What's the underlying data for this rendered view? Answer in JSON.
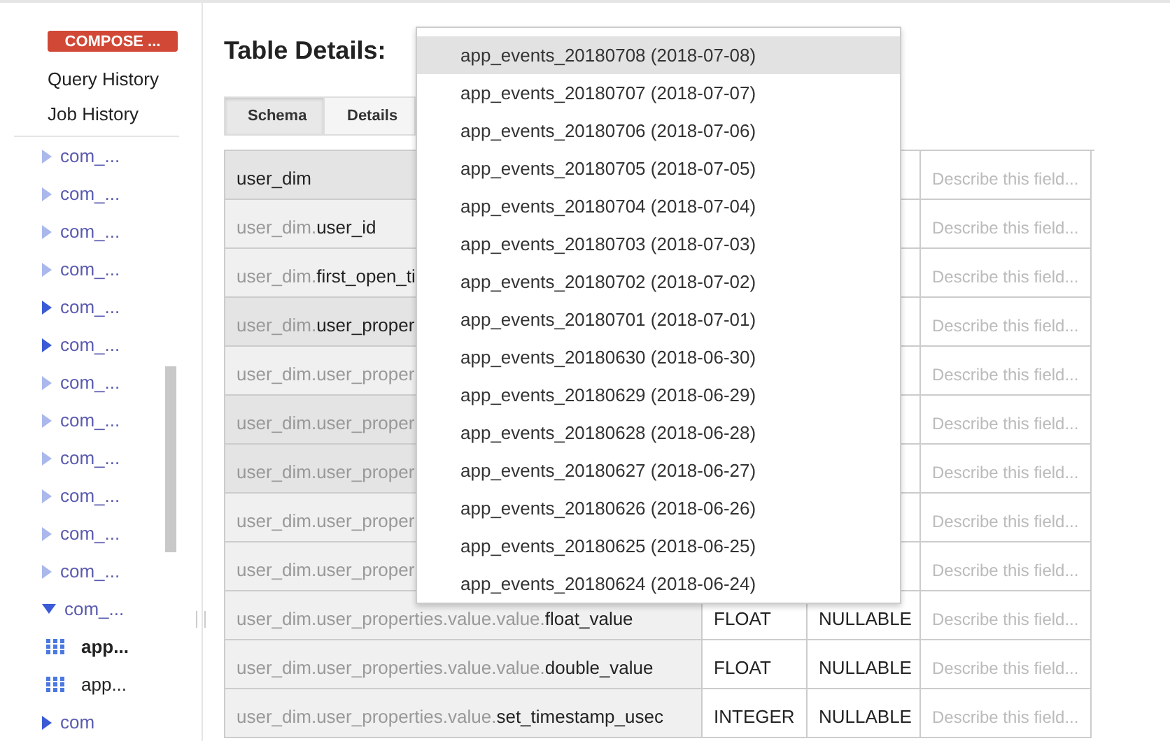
{
  "sidebar": {
    "compose_button": "COMPOSE ...",
    "links": [
      "Query History",
      "Job History"
    ],
    "tree": [
      {
        "label": "com_...",
        "expanded": false,
        "highlighted": false
      },
      {
        "label": "com_...",
        "expanded": false,
        "highlighted": false
      },
      {
        "label": "com_...",
        "expanded": false,
        "highlighted": false
      },
      {
        "label": "com_...",
        "expanded": false,
        "highlighted": false
      },
      {
        "label": "com_...",
        "expanded": false,
        "highlighted": true
      },
      {
        "label": "com_...",
        "expanded": false,
        "highlighted": true
      },
      {
        "label": "com_...",
        "expanded": false,
        "highlighted": false
      },
      {
        "label": "com_...",
        "expanded": false,
        "highlighted": false
      },
      {
        "label": "com_...",
        "expanded": false,
        "highlighted": false
      },
      {
        "label": "com_...",
        "expanded": false,
        "highlighted": false
      },
      {
        "label": "com_...",
        "expanded": false,
        "highlighted": false
      },
      {
        "label": "com_...",
        "expanded": false,
        "highlighted": false
      },
      {
        "label": "com_...",
        "expanded": true,
        "highlighted": true,
        "children": [
          {
            "label": "app...",
            "selected": true
          },
          {
            "label": "app...",
            "selected": false
          }
        ]
      },
      {
        "label": "com",
        "expanded": false,
        "highlighted": true
      }
    ]
  },
  "main": {
    "title": "Table Details:",
    "tabs": [
      {
        "label": "Schema",
        "selected": true
      },
      {
        "label": "Details",
        "selected": false
      }
    ],
    "table": {
      "rows": [
        {
          "kind": "record",
          "parent": "",
          "field": "user_dim",
          "description": "Describe this field..."
        },
        {
          "kind": "field",
          "parent": "user_dim.",
          "field": "user_id",
          "description": "Describe this field..."
        },
        {
          "kind": "field",
          "parent": "user_dim.",
          "field": "first_open_ti",
          "description": "Describe this field..."
        },
        {
          "kind": "record",
          "parent": "user_dim.",
          "field": "user_proper",
          "description": "Describe this field..."
        },
        {
          "kind": "field",
          "parent": "user_dim.user_proper",
          "field": "",
          "description": "Describe this field..."
        },
        {
          "kind": "record",
          "parent": "user_dim.user_proper",
          "field": "",
          "description": "Describe this field..."
        },
        {
          "kind": "record",
          "parent": "user_dim.user_proper",
          "field": "",
          "description": "Describe this field..."
        },
        {
          "kind": "field",
          "parent": "user_dim.user_proper",
          "field": "",
          "description": "Describe this field..."
        },
        {
          "kind": "field",
          "parent": "user_dim.user_proper",
          "field": "",
          "description": "Describe this field..."
        },
        {
          "kind": "field",
          "parent": "user_dim.user_properties.value.value.",
          "field": "float_value",
          "type": "FLOAT",
          "mode": "NULLABLE",
          "description": "Describe this field..."
        },
        {
          "kind": "field",
          "parent": "user_dim.user_properties.value.value.",
          "field": "double_value",
          "type": "FLOAT",
          "mode": "NULLABLE",
          "description": "Describe this field..."
        },
        {
          "kind": "field",
          "parent": "user_dim.user_properties.value.",
          "field": "set_timestamp_usec",
          "type": "INTEGER",
          "mode": "NULLABLE",
          "description": "Describe this field..."
        }
      ]
    }
  },
  "dropdown": {
    "items": [
      {
        "label": "app_events_20180708 (2018-07-08)",
        "selected": true
      },
      {
        "label": "app_events_20180707 (2018-07-07)",
        "selected": false
      },
      {
        "label": "app_events_20180706 (2018-07-06)",
        "selected": false
      },
      {
        "label": "app_events_20180705 (2018-07-05)",
        "selected": false
      },
      {
        "label": "app_events_20180704 (2018-07-04)",
        "selected": false
      },
      {
        "label": "app_events_20180703 (2018-07-03)",
        "selected": false
      },
      {
        "label": "app_events_20180702 (2018-07-02)",
        "selected": false
      },
      {
        "label": "app_events_20180701 (2018-07-01)",
        "selected": false
      },
      {
        "label": "app_events_20180630 (2018-06-30)",
        "selected": false
      },
      {
        "label": "app_events_20180629 (2018-06-29)",
        "selected": false
      },
      {
        "label": "app_events_20180628 (2018-06-28)",
        "selected": false
      },
      {
        "label": "app_events_20180627 (2018-06-27)",
        "selected": false
      },
      {
        "label": "app_events_20180626 (2018-06-26)",
        "selected": false
      },
      {
        "label": "app_events_20180625 (2018-06-25)",
        "selected": false
      },
      {
        "label": "app_events_20180624 (2018-06-24)",
        "selected": false
      }
    ]
  }
}
